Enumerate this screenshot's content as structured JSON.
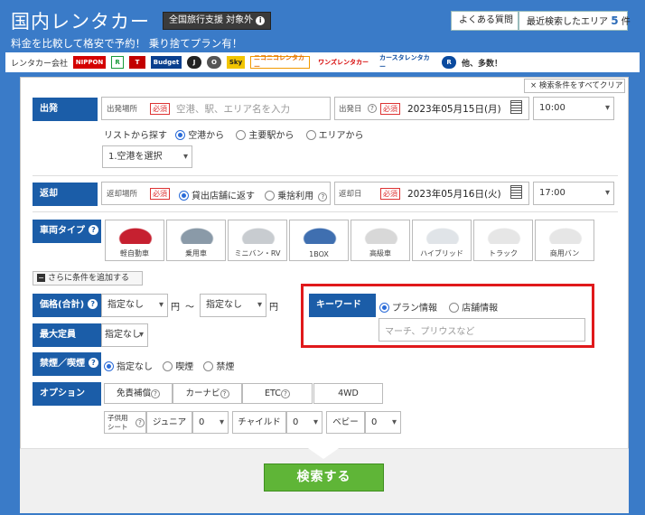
{
  "header": {
    "title": "国内レンタカー",
    "badge": "全国旅行支援 対象外",
    "subtitle": "料金を比較して格安で予約！ 乗り捨てプラン有！",
    "faq": "よくある質問",
    "recent_prefix": "最近検索したエリア",
    "recent_count": "5",
    "recent_suffix": "件"
  },
  "companies": {
    "label": "レンタカー会社",
    "logos": [
      "NIPPON",
      "トヨタ",
      "Times",
      "Budget",
      "J-NET",
      "OTS",
      "Sky",
      "ニコニコレンタカー",
      "ワンズレンタカー",
      "カースタレンタカー",
      "レンタカー"
    ],
    "more": "他、多数！"
  },
  "clear_all": "検索条件をすべてクリア",
  "departure": {
    "label": "出発",
    "place_label": "出発場所",
    "required": "必須",
    "place_placeholder": "空港、駅、エリア名を入力",
    "date_label": "出発日",
    "date_help": "?",
    "date_value": "2023年05月15日(月)",
    "time_value": "10:00",
    "list_label": "リストから探す",
    "list_options": [
      "空港から",
      "主要駅から",
      "エリアから"
    ],
    "airport_select": "1.空港を選択"
  },
  "return": {
    "label": "返却",
    "place_label": "返却場所",
    "required": "必須",
    "options": [
      "貸出店舗に返す",
      "乗捨利用"
    ],
    "help": "?",
    "date_label": "返却日",
    "date_value": "2023年05月16日(火)",
    "time_value": "17:00"
  },
  "car_type": {
    "label": "車両タイプ",
    "items": [
      "軽自動車",
      "乗用車",
      "ミニバン・RV",
      "1BOX",
      "高級車",
      "ハイブリッド",
      "トラック",
      "商用バン"
    ]
  },
  "add_conditions": "さらに条件を追加する",
  "price": {
    "label": "価格(合計)",
    "min": "指定なし",
    "max": "指定なし",
    "unit": "円",
    "tilde": "〜"
  },
  "capacity": {
    "label": "最大定員",
    "value": "指定なし"
  },
  "smoking": {
    "label": "禁煙／喫煙",
    "options": [
      "指定なし",
      "喫煙",
      "禁煙"
    ]
  },
  "keyword": {
    "label": "キーワード",
    "options": [
      "プラン情報",
      "店舗情報"
    ],
    "placeholder": "マーチ、プリウスなど"
  },
  "options": {
    "label": "オプション",
    "items": [
      "免責補償",
      "カーナビ",
      "ETC",
      "4WD"
    ],
    "child_seat_line1": "子供用",
    "child_seat_line2": "シート",
    "junior": "ジュニア",
    "junior_value": "0",
    "child": "チャイルド",
    "child_value": "0",
    "baby": "ベビー",
    "baby_value": "0"
  },
  "search_button": "検索する",
  "colors": {
    "accent": "#1b5da8",
    "header_bg": "#3a7bc8",
    "search": "#5fb537",
    "highlight": "#e0191b"
  }
}
